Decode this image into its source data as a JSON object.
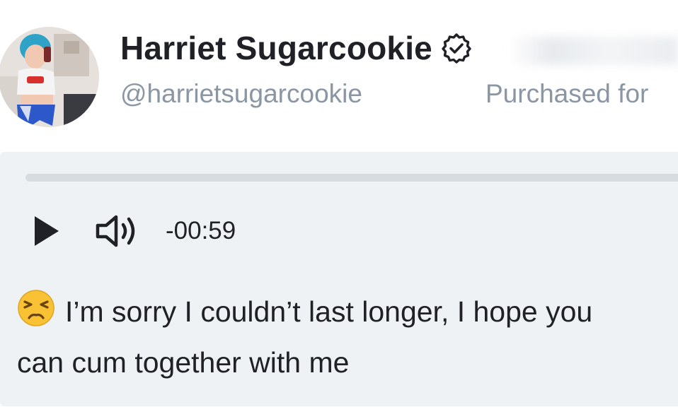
{
  "post": {
    "display_name": "Harriet Sugarcookie",
    "username": "@harrietsugarcookie",
    "purchased_label": "Purchased for",
    "verified_icon": "verified-badge-icon"
  },
  "audio": {
    "time_remaining": "-00:59",
    "progress_fraction": 0.0,
    "play_icon": "play-icon",
    "volume_icon": "volume-icon"
  },
  "message": {
    "emoji": "😣",
    "line1": "I’m sorry I couldn’t last longer, I hope you",
    "line2": "can cum together with me"
  },
  "colors": {
    "name": "#1f2126",
    "muted": "#8a96a3",
    "panel": "#eff2f4",
    "track": "#d7dce1"
  }
}
